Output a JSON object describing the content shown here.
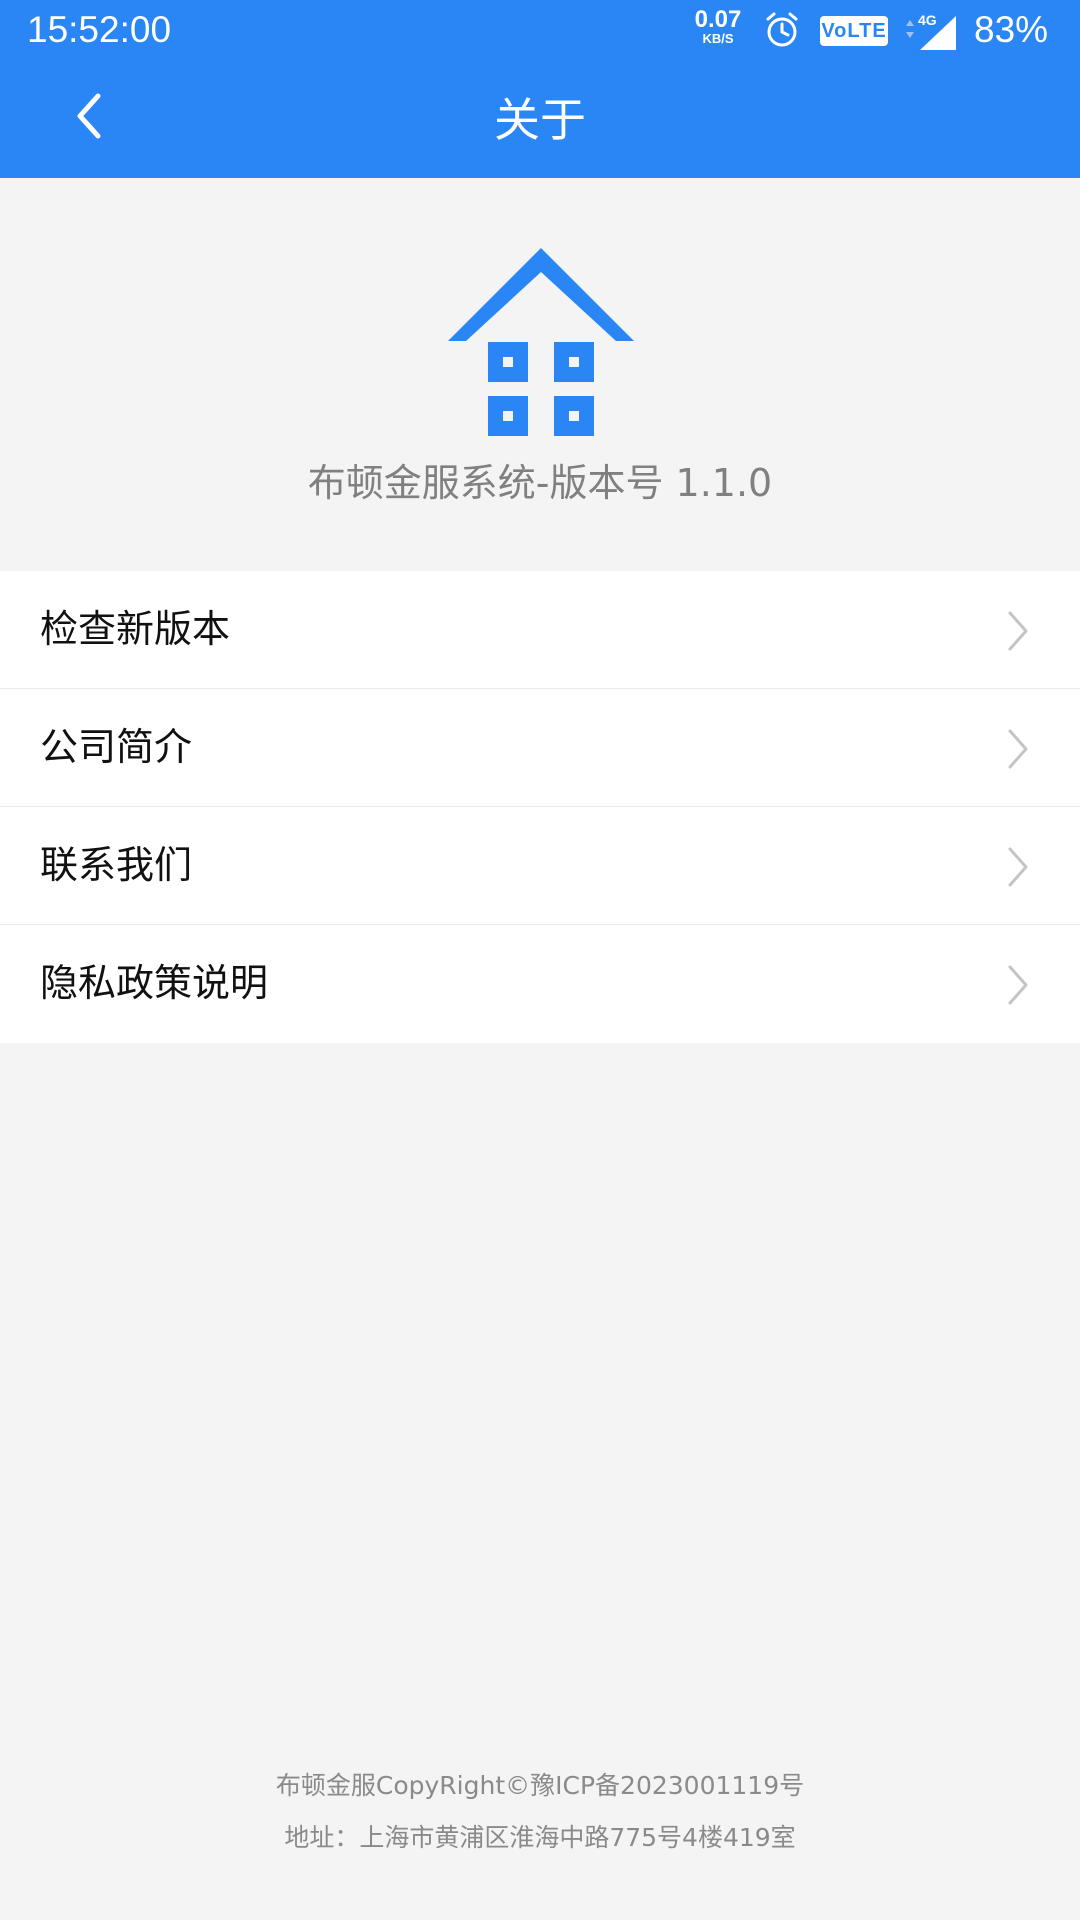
{
  "status_bar": {
    "time": "15:52:00",
    "net_rate": "0.07",
    "net_unit": "KB/S",
    "volte": "VoLTE",
    "network": "4G",
    "battery": "83%"
  },
  "nav": {
    "title": "关于",
    "back_icon": "chevron-left-icon"
  },
  "about": {
    "version_text": "布顿金服系统-版本号 1.1.0",
    "logo_icon": "house-icon"
  },
  "menu": {
    "items": [
      {
        "label": "检查新版本"
      },
      {
        "label": "公司简介"
      },
      {
        "label": "联系我们"
      },
      {
        "label": "隐私政策说明"
      }
    ]
  },
  "footer": {
    "copyright": "布顿金服CopyRight©豫ICP备2023001119号",
    "address": "地址：上海市黄浦区淮海中路775号4楼419室"
  },
  "colors": {
    "primary": "#2a86f4",
    "background": "#f4f4f4"
  }
}
